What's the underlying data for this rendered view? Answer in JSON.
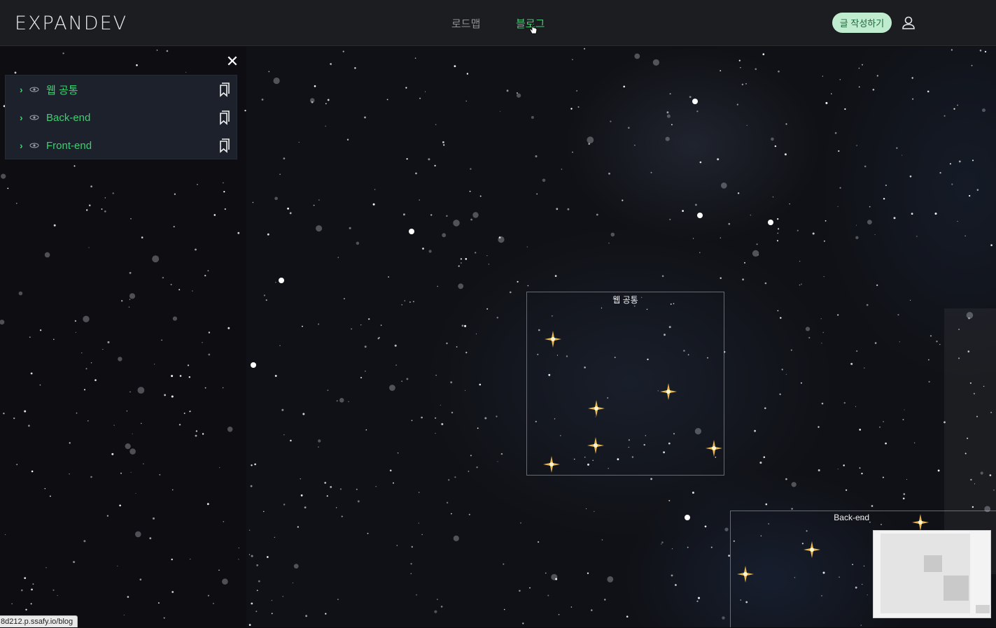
{
  "header": {
    "logo_text": "EXPANDEV",
    "nav": [
      {
        "label": "로드맵"
      },
      {
        "label": "블로그"
      }
    ],
    "write_button_label": "글 작성하기",
    "icons": {
      "user": "user-icon",
      "cursor": "pointer-cursor-icon"
    }
  },
  "sidebar": {
    "close_icon": "close-icon",
    "items": [
      {
        "label": "웹 공통",
        "icon": "galaxy-icon",
        "action_icon": "bookmarks-icon"
      },
      {
        "label": "Back-end",
        "icon": "galaxy-icon",
        "action_icon": "bookmarks-icon"
      },
      {
        "label": "Front-end",
        "icon": "galaxy-icon",
        "action_icon": "bookmarks-icon"
      }
    ]
  },
  "clusters": [
    {
      "title": "웹 공통",
      "post_count": 6
    },
    {
      "title": "Back-end",
      "post_count": 3
    }
  ],
  "status_bar": {
    "url": "8d212.p.ssafy.io/blog"
  },
  "colors": {
    "accent": "#3fcf72",
    "topbar_bg": "#1c1d20",
    "canvas_bg": "#101116",
    "sidebar_bg": "#1d212b",
    "button_bg": "#bfeccf"
  }
}
